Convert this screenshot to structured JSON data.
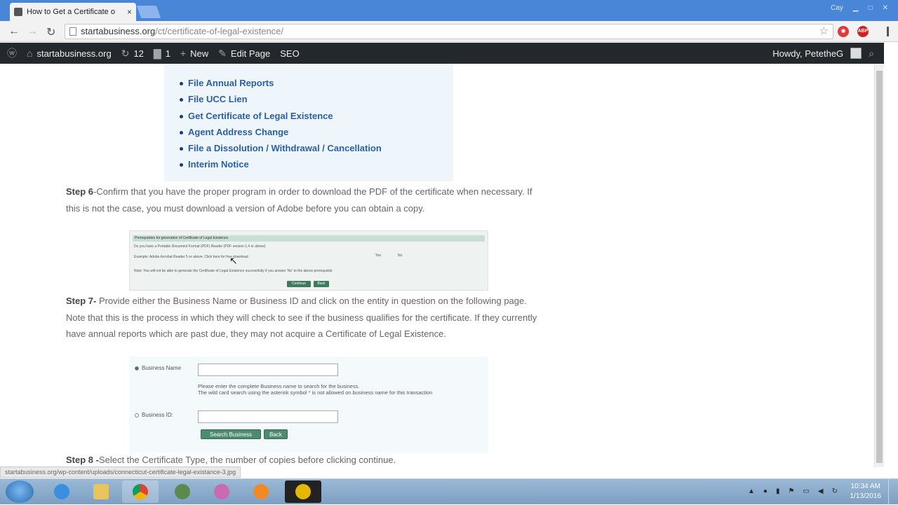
{
  "browser": {
    "tab_title": "How to Get a Certificate o",
    "tab_close": "×",
    "window_user": "Cay",
    "url_domain": "startabusiness.org",
    "url_path": "/ct/certificate-of-legal-existence/",
    "ext_badge": "ABP"
  },
  "adminbar": {
    "site": "startabusiness.org",
    "updates": "12",
    "comments": "1",
    "new": "New",
    "edit": "Edit Page",
    "seo": "SEO",
    "howdy": "Howdy, PetetheG"
  },
  "options_box": {
    "items": [
      "File Annual Reports",
      "File UCC Lien",
      "Get Certificate of Legal Existence",
      "Agent Address Change",
      "File a Dissolution / Withdrawal / Cancellation",
      "Interim Notice"
    ]
  },
  "step6": {
    "label": "Step 6",
    "text": "-Confirm that you have the proper program in order to download the PDF of the certificate when necessary. If this is not the case, you must download a version of Adobe before you can obtain a copy."
  },
  "prereq": {
    "header": "Prerequisites for generation of Certificate of Legal Existence",
    "question": "Do you have a Portable Document Format (PDF) Reader (PDF version 1.4 or above)",
    "example": "Example: Adobe Acrobat Reader 5 or above. Click here for free download",
    "yes": "Yes",
    "no": "No",
    "note": "Note: You will not be able to generate the Certificate of Legal Existence successfully if you answer 'No' to the above prerequisite",
    "continue": "Continue",
    "back": "Back"
  },
  "step7": {
    "label": "Step 7-",
    "text": " Provide either the Business Name or Business ID and click on the entity in question on the following page. Note that this is the process in which they will check to see if the business qualifies for the certificate. If they currently have annual reports which are past due, they may not acquire a Certificate of Legal Existence."
  },
  "search_form": {
    "name_label": "Business Name",
    "help_1": "Please enter the complete Business name to search for the business.",
    "help_2": "The wild card search using the asterisk symbol * is not allowed on business name for this transaction",
    "id_label": "Business ID:",
    "search_btn": "Search Business",
    "back_btn": "Back"
  },
  "step8": {
    "label": "Step 8 -",
    "text": "Select the Certificate Type, the number of copies before clicking continue."
  },
  "status_url": "startabusiness.org/wp-content/uploads/connecticut-certificate-legal-existance-3.jpg",
  "taskbar": {
    "time": "10:34 AM",
    "date": "1/13/2016"
  }
}
